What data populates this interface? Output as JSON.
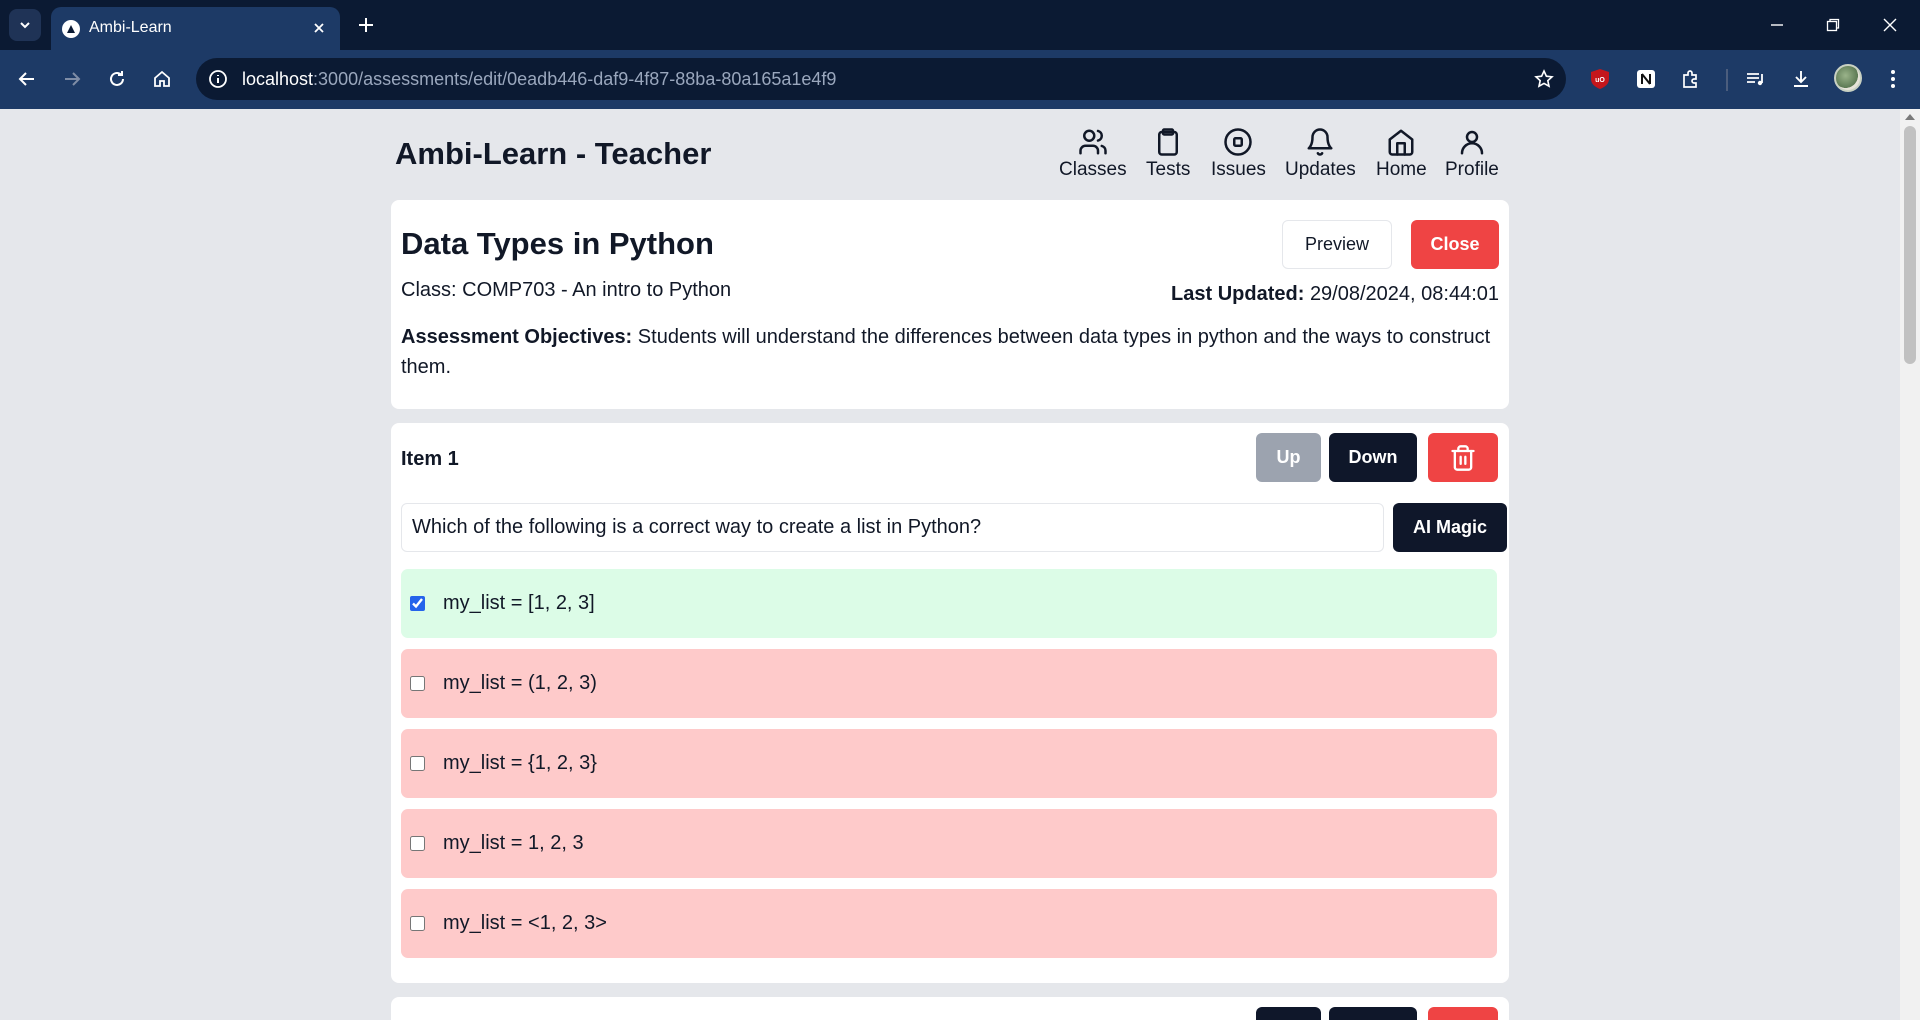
{
  "browser": {
    "tab_title": "Ambi-Learn",
    "url_host": "localhost",
    "url_rest": ":3000/assessments/edit/0eadb446-daf9-4f87-88ba-80a165a1e4f9"
  },
  "app": {
    "title": "Ambi-Learn - Teacher",
    "nav": [
      {
        "label": "Classes",
        "icon": "users-icon"
      },
      {
        "label": "Tests",
        "icon": "clipboard-icon"
      },
      {
        "label": "Issues",
        "icon": "stop-circle-icon"
      },
      {
        "label": "Updates",
        "icon": "bell-icon"
      },
      {
        "label": "Home",
        "icon": "home-icon"
      },
      {
        "label": "Profile",
        "icon": "user-icon"
      }
    ]
  },
  "assessment": {
    "title": "Data Types in Python",
    "class_text": "Class: COMP703 - An intro to Python",
    "last_updated_label": "Last Updated:",
    "last_updated_value": "29/08/2024, 08:44:01",
    "objectives_label": "Assessment Objectives:",
    "objectives_text": "Students will understand the differences between data types in python and the ways to construct them.",
    "preview_label": "Preview",
    "close_label": "Close"
  },
  "item": {
    "title": "Item 1",
    "up_label": "Up",
    "down_label": "Down",
    "question": "Which of the following is a correct way to create a list in Python?",
    "ai_label": "AI Magic",
    "options": [
      {
        "text": "my_list = [1, 2, 3]",
        "correct": true
      },
      {
        "text": "my_list = (1, 2, 3)",
        "correct": false
      },
      {
        "text": "my_list = {1, 2, 3}",
        "correct": false
      },
      {
        "text": "my_list = 1, 2, 3",
        "correct": false
      },
      {
        "text": "my_list = <1, 2, 3>",
        "correct": false
      }
    ]
  },
  "colors": {
    "danger": "#ef4444",
    "dark": "#0f172a",
    "correct_bg": "#dcfce7",
    "wrong_bg": "#fecaca"
  }
}
